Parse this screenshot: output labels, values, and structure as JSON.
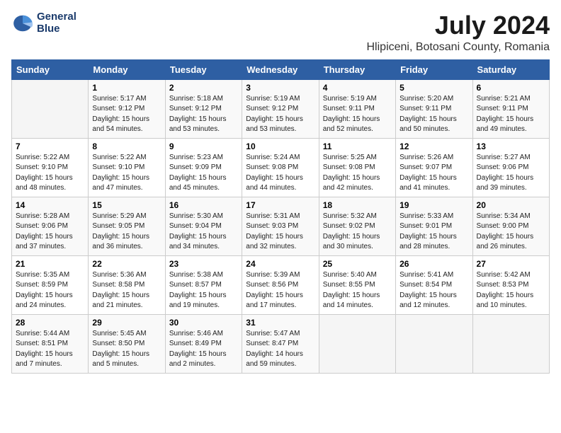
{
  "logo": {
    "line1": "General",
    "line2": "Blue"
  },
  "title": "July 2024",
  "location": "Hlipiceni, Botosani County, Romania",
  "days_header": [
    "Sunday",
    "Monday",
    "Tuesday",
    "Wednesday",
    "Thursday",
    "Friday",
    "Saturday"
  ],
  "weeks": [
    [
      {
        "day": "",
        "info": ""
      },
      {
        "day": "1",
        "info": "Sunrise: 5:17 AM\nSunset: 9:12 PM\nDaylight: 15 hours\nand 54 minutes."
      },
      {
        "day": "2",
        "info": "Sunrise: 5:18 AM\nSunset: 9:12 PM\nDaylight: 15 hours\nand 53 minutes."
      },
      {
        "day": "3",
        "info": "Sunrise: 5:19 AM\nSunset: 9:12 PM\nDaylight: 15 hours\nand 53 minutes."
      },
      {
        "day": "4",
        "info": "Sunrise: 5:19 AM\nSunset: 9:11 PM\nDaylight: 15 hours\nand 52 minutes."
      },
      {
        "day": "5",
        "info": "Sunrise: 5:20 AM\nSunset: 9:11 PM\nDaylight: 15 hours\nand 50 minutes."
      },
      {
        "day": "6",
        "info": "Sunrise: 5:21 AM\nSunset: 9:11 PM\nDaylight: 15 hours\nand 49 minutes."
      }
    ],
    [
      {
        "day": "7",
        "info": "Sunrise: 5:22 AM\nSunset: 9:10 PM\nDaylight: 15 hours\nand 48 minutes."
      },
      {
        "day": "8",
        "info": "Sunrise: 5:22 AM\nSunset: 9:10 PM\nDaylight: 15 hours\nand 47 minutes."
      },
      {
        "day": "9",
        "info": "Sunrise: 5:23 AM\nSunset: 9:09 PM\nDaylight: 15 hours\nand 45 minutes."
      },
      {
        "day": "10",
        "info": "Sunrise: 5:24 AM\nSunset: 9:08 PM\nDaylight: 15 hours\nand 44 minutes."
      },
      {
        "day": "11",
        "info": "Sunrise: 5:25 AM\nSunset: 9:08 PM\nDaylight: 15 hours\nand 42 minutes."
      },
      {
        "day": "12",
        "info": "Sunrise: 5:26 AM\nSunset: 9:07 PM\nDaylight: 15 hours\nand 41 minutes."
      },
      {
        "day": "13",
        "info": "Sunrise: 5:27 AM\nSunset: 9:06 PM\nDaylight: 15 hours\nand 39 minutes."
      }
    ],
    [
      {
        "day": "14",
        "info": "Sunrise: 5:28 AM\nSunset: 9:06 PM\nDaylight: 15 hours\nand 37 minutes."
      },
      {
        "day": "15",
        "info": "Sunrise: 5:29 AM\nSunset: 9:05 PM\nDaylight: 15 hours\nand 36 minutes."
      },
      {
        "day": "16",
        "info": "Sunrise: 5:30 AM\nSunset: 9:04 PM\nDaylight: 15 hours\nand 34 minutes."
      },
      {
        "day": "17",
        "info": "Sunrise: 5:31 AM\nSunset: 9:03 PM\nDaylight: 15 hours\nand 32 minutes."
      },
      {
        "day": "18",
        "info": "Sunrise: 5:32 AM\nSunset: 9:02 PM\nDaylight: 15 hours\nand 30 minutes."
      },
      {
        "day": "19",
        "info": "Sunrise: 5:33 AM\nSunset: 9:01 PM\nDaylight: 15 hours\nand 28 minutes."
      },
      {
        "day": "20",
        "info": "Sunrise: 5:34 AM\nSunset: 9:00 PM\nDaylight: 15 hours\nand 26 minutes."
      }
    ],
    [
      {
        "day": "21",
        "info": "Sunrise: 5:35 AM\nSunset: 8:59 PM\nDaylight: 15 hours\nand 24 minutes."
      },
      {
        "day": "22",
        "info": "Sunrise: 5:36 AM\nSunset: 8:58 PM\nDaylight: 15 hours\nand 21 minutes."
      },
      {
        "day": "23",
        "info": "Sunrise: 5:38 AM\nSunset: 8:57 PM\nDaylight: 15 hours\nand 19 minutes."
      },
      {
        "day": "24",
        "info": "Sunrise: 5:39 AM\nSunset: 8:56 PM\nDaylight: 15 hours\nand 17 minutes."
      },
      {
        "day": "25",
        "info": "Sunrise: 5:40 AM\nSunset: 8:55 PM\nDaylight: 15 hours\nand 14 minutes."
      },
      {
        "day": "26",
        "info": "Sunrise: 5:41 AM\nSunset: 8:54 PM\nDaylight: 15 hours\nand 12 minutes."
      },
      {
        "day": "27",
        "info": "Sunrise: 5:42 AM\nSunset: 8:53 PM\nDaylight: 15 hours\nand 10 minutes."
      }
    ],
    [
      {
        "day": "28",
        "info": "Sunrise: 5:44 AM\nSunset: 8:51 PM\nDaylight: 15 hours\nand 7 minutes."
      },
      {
        "day": "29",
        "info": "Sunrise: 5:45 AM\nSunset: 8:50 PM\nDaylight: 15 hours\nand 5 minutes."
      },
      {
        "day": "30",
        "info": "Sunrise: 5:46 AM\nSunset: 8:49 PM\nDaylight: 15 hours\nand 2 minutes."
      },
      {
        "day": "31",
        "info": "Sunrise: 5:47 AM\nSunset: 8:47 PM\nDaylight: 14 hours\nand 59 minutes."
      },
      {
        "day": "",
        "info": ""
      },
      {
        "day": "",
        "info": ""
      },
      {
        "day": "",
        "info": ""
      }
    ]
  ]
}
